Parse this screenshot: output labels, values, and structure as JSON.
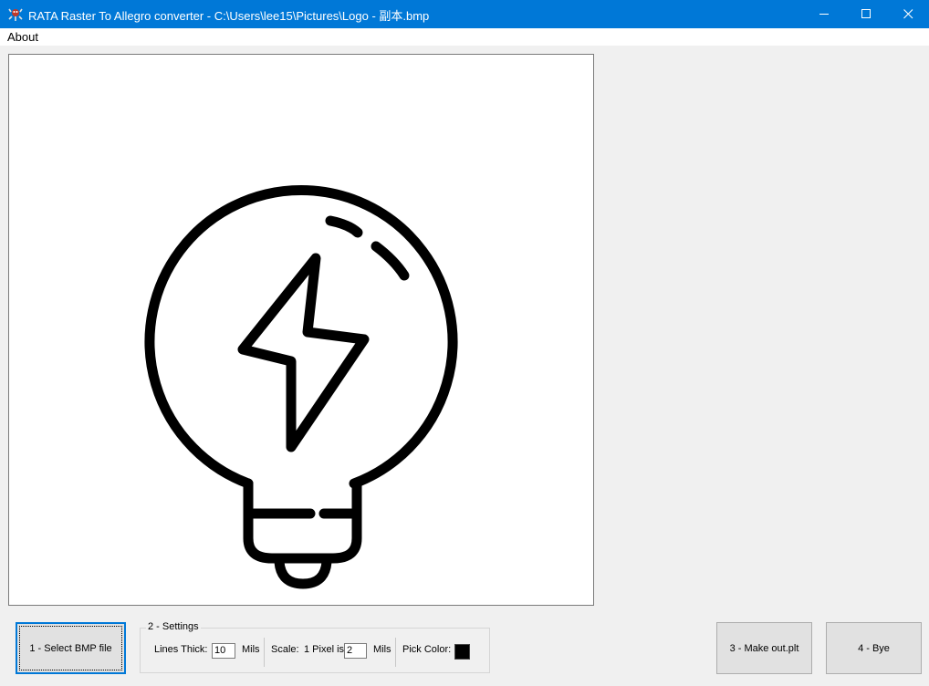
{
  "window": {
    "title": "RATA Raster To Allegro converter - C:\\Users\\lee15\\Pictures\\Logo - 副本.bmp",
    "icon": "rata-app-icon",
    "accent": "#0078d7"
  },
  "menu": {
    "about": "About"
  },
  "preview": {
    "image": "lightbulb-with-lightning-bolt"
  },
  "buttons": {
    "select_bmp": "1 - Select BMP file",
    "make_out": "3 - Make out.plt",
    "bye": "4 - Bye"
  },
  "settings": {
    "legend": "2 - Settings",
    "lines_thick_label": "Lines Thick:",
    "lines_thick_value": "10",
    "lines_thick_unit": "Mils",
    "scale_label": "Scale:",
    "scale_prefix": "1 Pixel is",
    "scale_value": "2",
    "scale_unit": "Mils",
    "pick_color_label": "Pick Color:",
    "pick_color_value": "#000000"
  }
}
